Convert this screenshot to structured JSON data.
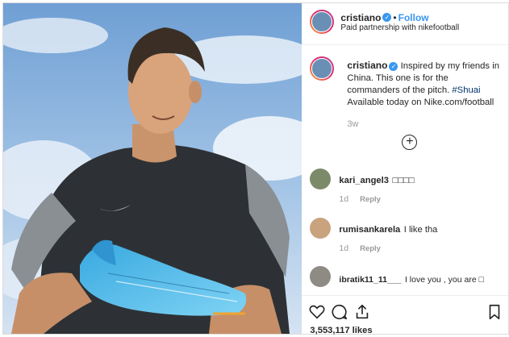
{
  "header": {
    "username": "cristiano",
    "verified_mark": "✓",
    "separator": "•",
    "follow_label": "Follow",
    "subtitle": "Paid partnership with nikefootball"
  },
  "caption": {
    "username": "cristiano",
    "text": "Inspired by my friends in China. This one is for the commanders of the pitch.",
    "hashtag": "#Shuai",
    "line2": "Available today on Nike.com/football",
    "time": "3w"
  },
  "load_more_label": "+",
  "comments": [
    {
      "username": "kari_angel3",
      "text": "□□□□",
      "time": "1d",
      "reply_label": "Reply"
    },
    {
      "username": "rumisankarela",
      "text": "I like tha",
      "time": "1d",
      "reply_label": "Reply"
    },
    {
      "username": "ibratik11_11___",
      "text": "I love you , you are □"
    }
  ],
  "actions": {
    "like_icon": "heart-icon",
    "comment_icon": "comment-icon",
    "share_icon": "share-icon",
    "save_icon": "bookmark-icon",
    "likes_count": "3,553,117",
    "likes_label": "likes"
  },
  "colors": {
    "accent": "#3897f0",
    "hashtag": "#003569",
    "muted": "#999999"
  }
}
